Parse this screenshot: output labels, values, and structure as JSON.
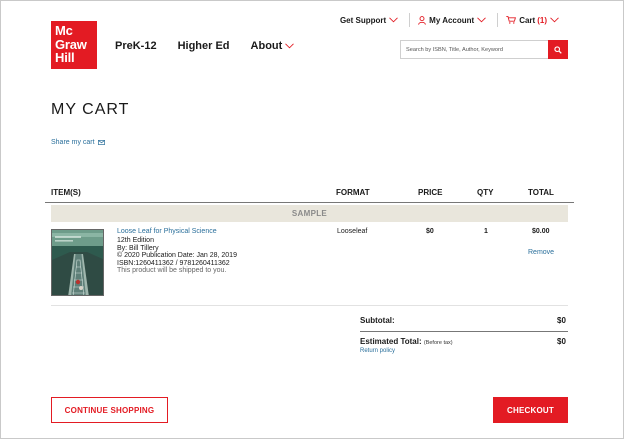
{
  "logo": {
    "lines": [
      "Mc",
      "Graw",
      "Hill"
    ]
  },
  "utility_nav": {
    "support": "Get Support",
    "account": "My Account",
    "cart": "Cart",
    "cart_count": "(1)"
  },
  "main_nav": {
    "items": [
      "PreK-12",
      "Higher Ed",
      "About"
    ]
  },
  "search": {
    "placeholder": "Search by ISBN, Title, Author, Keyword"
  },
  "page": {
    "title": "MY CART",
    "share_link": "Share my cart"
  },
  "table": {
    "headers": {
      "item": "ITEM(S)",
      "format": "FORMAT",
      "price": "PRICE",
      "qty": "QTY",
      "total": "TOTAL"
    },
    "section_label": "SAMPLE"
  },
  "product": {
    "title": "Loose Leaf for Physical Science",
    "edition": "12th Edition",
    "author": "By: Bill Tillery",
    "publication": "© 2020 Publication Date: Jan 28, 2019",
    "isbn": "ISBN:1260411362 / 9781260411362",
    "shipping": "This product will be shipped to you.",
    "format": "Looseleaf",
    "price": "$0",
    "qty": "1",
    "total": "$0.00",
    "remove": "Remove"
  },
  "summary": {
    "subtotal_label": "Subtotal:",
    "subtotal_value": "$0",
    "estimated_label": "Estimated Total:",
    "estimated_note": "(Before tax)",
    "estimated_value": "$0",
    "return_policy": "Return policy"
  },
  "actions": {
    "continue_shopping": "CONTINUE SHOPPING",
    "checkout": "CHECKOUT"
  },
  "colors": {
    "brand_red": "#e31b23",
    "link_blue": "#2a6f9b",
    "sample_bg": "#e9e6dc"
  },
  "icons": [
    "user-icon",
    "cart-icon",
    "search-icon",
    "envelope-icon",
    "chevron-down-icon"
  ]
}
